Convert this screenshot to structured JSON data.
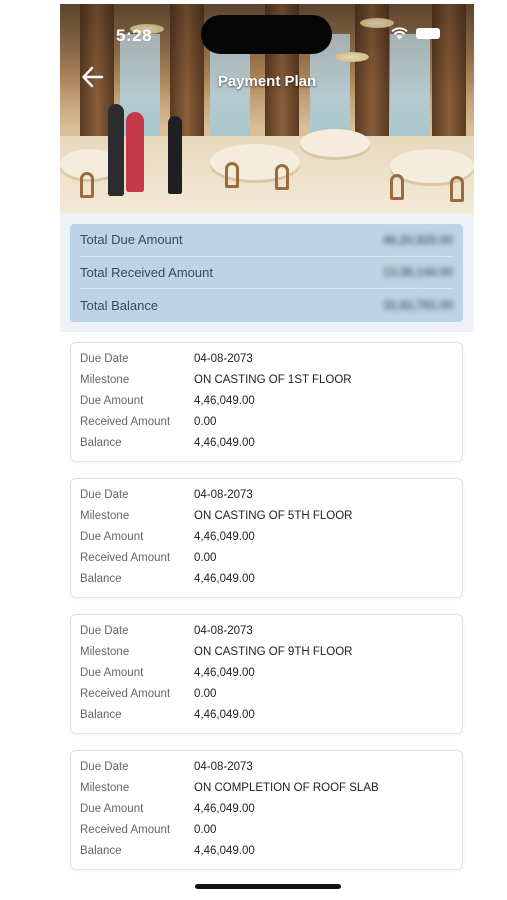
{
  "status_bar": {
    "time": "5:28"
  },
  "header": {
    "title": "Payment Plan"
  },
  "summary": [
    {
      "label": "Total Due Amount",
      "value": "46,20,925.00"
    },
    {
      "label": "Total Received Amount",
      "value": "13,38,144.00"
    },
    {
      "label": "Total Balance",
      "value": "32,82,781.00"
    }
  ],
  "field_labels": {
    "due_date": "Due Date",
    "milestone": "Milestone",
    "due_amount": "Due Amount",
    "received_amount": "Received Amount",
    "balance": "Balance"
  },
  "installments": [
    {
      "due_date": "04-08-2073",
      "milestone": "ON CASTING OF 1ST FLOOR",
      "due_amount": "4,46,049.00",
      "received_amount": "0.00",
      "balance": "4,46,049.00"
    },
    {
      "due_date": "04-08-2073",
      "milestone": "ON CASTING OF 5TH FLOOR",
      "due_amount": "4,46,049.00",
      "received_amount": "0.00",
      "balance": "4,46,049.00"
    },
    {
      "due_date": "04-08-2073",
      "milestone": "ON CASTING OF 9TH FLOOR",
      "due_amount": "4,46,049.00",
      "received_amount": "0.00",
      "balance": "4,46,049.00"
    },
    {
      "due_date": "04-08-2073",
      "milestone": "ON COMPLETION OF ROOF SLAB",
      "due_amount": "4,46,049.00",
      "received_amount": "0.00",
      "balance": "4,46,049.00"
    }
  ],
  "icons": {
    "back": "arrow-left-icon",
    "wifi": "wifi-icon",
    "battery": "battery-icon"
  },
  "colors": {
    "summary_background": "#bcd4e5",
    "card_border": "#dfe2e6"
  }
}
